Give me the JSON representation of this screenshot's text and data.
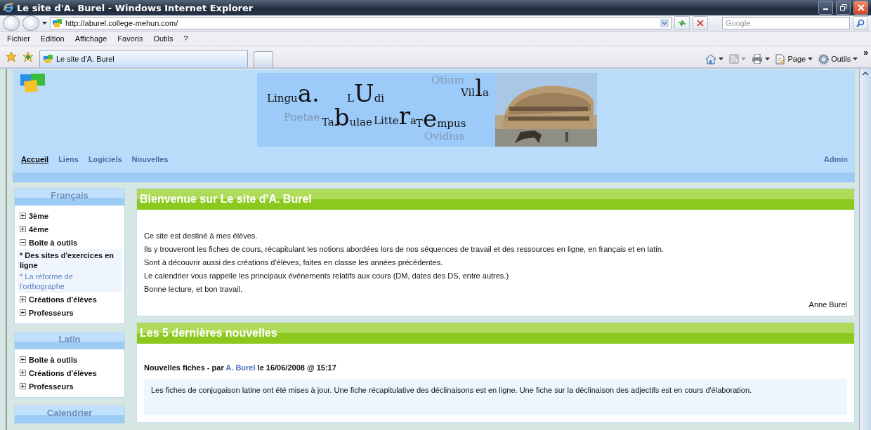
{
  "window": {
    "title": "Le site d'A. Burel - Windows Internet Explorer"
  },
  "address_bar": {
    "url": "http://aburel.college-mehun.com/"
  },
  "search": {
    "placeholder": "Google"
  },
  "menu": [
    "Fichier",
    "Edition",
    "Affichage",
    "Favoris",
    "Outils",
    "?"
  ],
  "tabs": [
    {
      "label": "Le site d'A. Burel",
      "selected": true
    }
  ],
  "toolbar": [
    {
      "kind": "home",
      "disabled": false
    },
    {
      "kind": "feed",
      "disabled": true
    },
    {
      "kind": "print",
      "disabled": false
    },
    {
      "kind": "page",
      "label": "Page",
      "disabled": false
    },
    {
      "kind": "tools",
      "label": "Outils",
      "disabled": false
    }
  ],
  "toolbar_overflow": "»",
  "site": {
    "banner": {
      "words": [
        {
          "parts": [
            {
              "text": "Lingu",
              "big": false
            },
            {
              "text": "a.",
              "big": true
            }
          ],
          "faded": false
        },
        {
          "parts": [
            {
              "text": "L",
              "big": false
            },
            {
              "text": "U",
              "big": true
            },
            {
              "text": "di",
              "big": false
            }
          ],
          "faded": false
        },
        {
          "parts": [
            {
              "text": "Otium",
              "big": false
            }
          ],
          "faded": true
        },
        {
          "parts": [
            {
              "text": "Vil",
              "big": false
            },
            {
              "text": "l",
              "big": true
            },
            {
              "text": "a",
              "big": false
            }
          ],
          "faded": false
        },
        {
          "parts": [
            {
              "text": "Poetae",
              "big": false
            }
          ],
          "faded": true
        },
        {
          "parts": [
            {
              "text": "Ta",
              "big": false
            },
            {
              "text": "b",
              "big": true
            },
            {
              "text": "ulae",
              "big": false
            }
          ],
          "faded": false
        },
        {
          "parts": [
            {
              "text": "Litte",
              "big": false
            },
            {
              "text": "r",
              "big": true
            },
            {
              "text": "a",
              "big": false
            }
          ],
          "faded": false
        },
        {
          "parts": [
            {
              "text": "T",
              "big": false
            },
            {
              "text": "e",
              "big": true
            },
            {
              "text": "mpus",
              "big": false
            }
          ],
          "faded": false
        },
        {
          "parts": [
            {
              "text": "Ovidius",
              "big": false
            }
          ],
          "faded": true
        }
      ]
    },
    "nav": [
      {
        "label": "Accueil",
        "selected": true
      },
      {
        "label": "Liens",
        "selected": false
      },
      {
        "label": "Logiciels",
        "selected": false
      },
      {
        "label": "Nouvelles",
        "selected": false
      }
    ],
    "admin": "Admin"
  },
  "sidebar": [
    {
      "title": "Français",
      "items": [
        {
          "label": "3ème",
          "expanded": false
        },
        {
          "label": "4ème",
          "expanded": false
        },
        {
          "label": "Boîte à outils",
          "expanded": true,
          "children": [
            {
              "bullet": "*",
              "label": "Des sites d'exercices en ligne",
              "selected": true
            },
            {
              "bullet": "*",
              "label": "La réforme de l'orthographe",
              "selected": false
            }
          ]
        },
        {
          "label": "Créations d'élèves",
          "expanded": false
        },
        {
          "label": "Professeurs",
          "expanded": false
        }
      ]
    },
    {
      "title": "Latin",
      "items": [
        {
          "label": "Boîte à outils",
          "expanded": false
        },
        {
          "label": "Créations d'élèves",
          "expanded": false
        },
        {
          "label": "Professeurs",
          "expanded": false
        }
      ]
    },
    {
      "title": "Calendrier"
    }
  ],
  "welcome": {
    "title": "Bienvenue sur Le site d'A. Burel",
    "lines": [
      "Ce site est destiné à mes élèves.",
      "Ils y trouveront les fiches de cours, récapitulant les notions abordées lors de nos séquences de travail et des ressources en ligne, en français et en latin.",
      "Sont à découvrir aussi des créations d'élèves, faites en classe les années précédentes.",
      "Le calendrier vous rappelle les principaux événements relatifs aux cours (DM, dates des DS, entre autres.)",
      "Bonne lecture, et bon travail."
    ],
    "signature": "Anne Burel"
  },
  "news": {
    "title": "Les 5 dernières nouvelles",
    "items": [
      {
        "heading": "Nouvelles fiches - par ",
        "author": "A. Burel",
        "date": " le 16/06/2008 @ 15:17",
        "body": "Les fiches de conjugaison latine ont été mises à jour. Une fiche récapitulative des déclinaisons est en ligne. Une fiche sur la déclinaison des adjectifs est en cours d'élaboration."
      }
    ]
  }
}
